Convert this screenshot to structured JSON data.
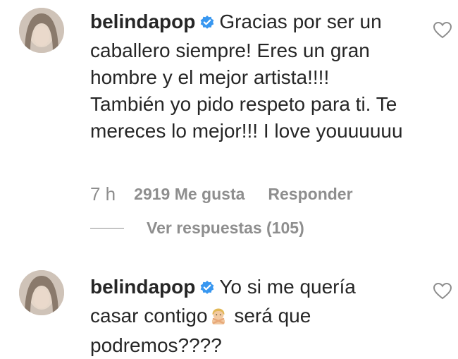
{
  "comments": [
    {
      "username": "belindapop",
      "text": "Gracias por ser un caballero siempre! Eres un gran hombre y el mejor artista!!!! También yo pido respeto para ti. Te mereces lo mejor!!! I love youuuuuu",
      "time": "7 h",
      "likes": "2919 Me gusta",
      "reply_label": "Responder",
      "view_replies": "Ver respuestas (105)"
    },
    {
      "username": "belindapop",
      "text_before_emoji": "Yo si me quería casar contigo",
      "emoji": "person-gesturing-no-emoji",
      "text_after_emoji": " será que podremos????"
    }
  ],
  "icons": {
    "verified": "verified-badge-icon",
    "like": "heart-outline-icon"
  },
  "colors": {
    "text": "#262626",
    "secondary": "#8e8e8e",
    "verified_blue": "#3897f0"
  }
}
